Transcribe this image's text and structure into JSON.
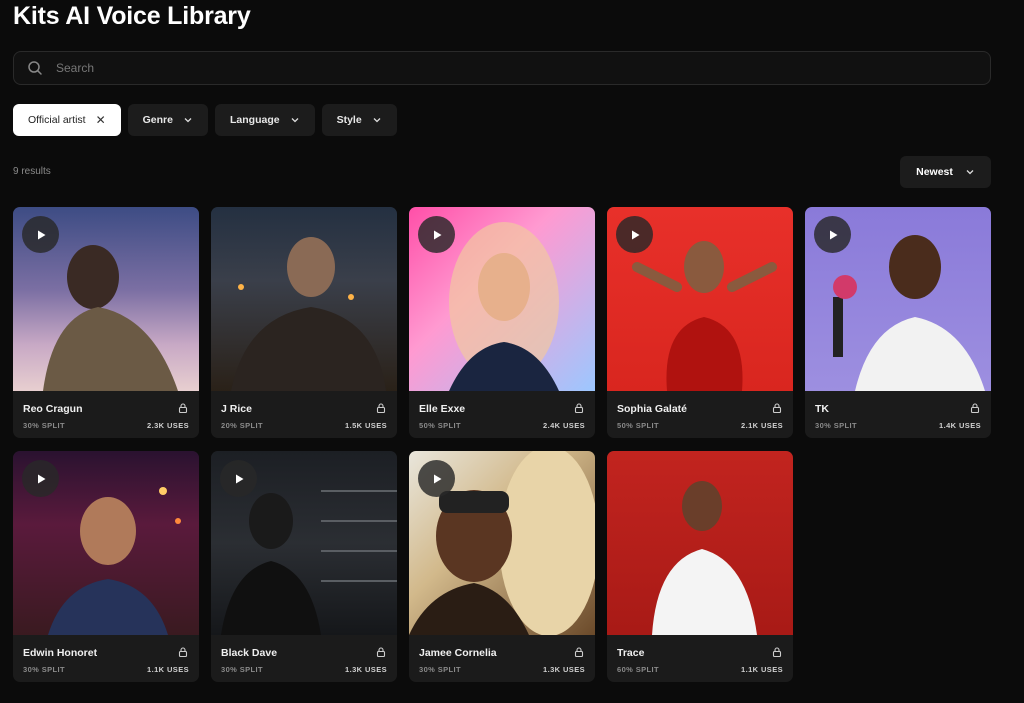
{
  "page": {
    "title": "Kits AI Voice Library"
  },
  "search": {
    "placeholder": "Search"
  },
  "filters": {
    "official_artist": "Official artist",
    "genre": "Genre",
    "language": "Language",
    "style": "Style"
  },
  "results_label": "9 results",
  "sort": {
    "label": "Newest"
  },
  "cards": [
    {
      "name": "Reo Cragun",
      "split": "30% SPLIT",
      "uses": "2.3K USES"
    },
    {
      "name": "J Rice",
      "split": "20% SPLIT",
      "uses": "1.5K USES"
    },
    {
      "name": "Elle Exxe",
      "split": "50% SPLIT",
      "uses": "2.4K USES"
    },
    {
      "name": "Sophia Galaté",
      "split": "50% SPLIT",
      "uses": "2.1K USES"
    },
    {
      "name": "TK",
      "split": "30% SPLIT",
      "uses": "1.4K USES"
    },
    {
      "name": "Edwin Honoret",
      "split": "30% SPLIT",
      "uses": "1.1K USES"
    },
    {
      "name": "Black Dave",
      "split": "30% SPLIT",
      "uses": "1.3K USES"
    },
    {
      "name": "Jamee Cornelia",
      "split": "30% SPLIT",
      "uses": "1.3K USES"
    },
    {
      "name": "Trace",
      "split": "60% SPLIT",
      "uses": "1.1K USES"
    }
  ],
  "icons": {
    "search": "search-icon",
    "close": "close-icon",
    "chevron": "chevron-down-icon",
    "play": "play-icon",
    "lock": "lock-icon"
  }
}
